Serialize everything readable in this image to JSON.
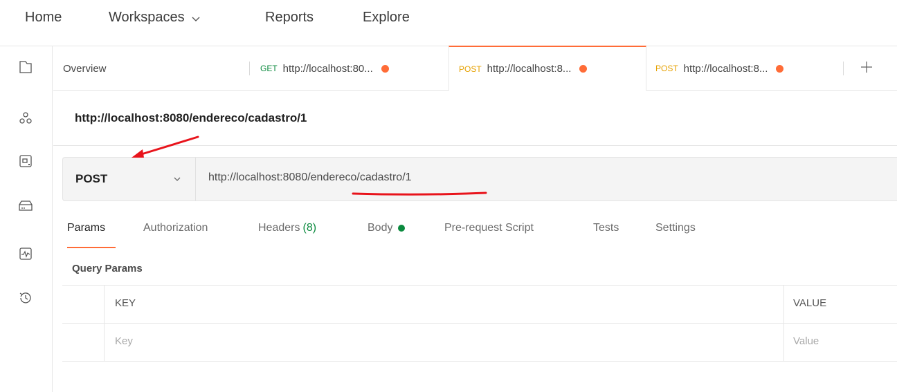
{
  "topnav": {
    "home": "Home",
    "workspaces": "Workspaces",
    "reports": "Reports",
    "explore": "Explore"
  },
  "rail": {
    "icons": [
      "collections-icon",
      "apis-icon",
      "environments-icon",
      "mock-servers-icon",
      "monitors-icon",
      "history-icon"
    ]
  },
  "tabs": [
    {
      "label": "Overview"
    },
    {
      "method": "GET",
      "label": "http://localhost:80...",
      "unsaved": true
    },
    {
      "method": "POST",
      "label": "http://localhost:8...",
      "unsaved": true,
      "active": true
    },
    {
      "method": "POST",
      "label": "http://localhost:8...",
      "unsaved": true
    }
  ],
  "request": {
    "name": "http://localhost:8080/endereco/cadastro/1",
    "method": "POST",
    "url_prefix": "http://localhost:8080/",
    "url_path": "endereco/cadastro/1"
  },
  "subtabs": {
    "params": "Params",
    "authorization": "Authorization",
    "headers": "Headers",
    "headers_count": "(8)",
    "body": "Body",
    "prerequest": "Pre-request Script",
    "tests": "Tests",
    "settings": "Settings"
  },
  "query_params": {
    "title": "Query Params",
    "columns": [
      "KEY",
      "VALUE"
    ],
    "placeholders": [
      "Key",
      "Value"
    ]
  },
  "colors": {
    "accent": "#ff6c37",
    "get": "#0b8a3e",
    "post": "#e6a100",
    "annotation": "#e8131b"
  }
}
